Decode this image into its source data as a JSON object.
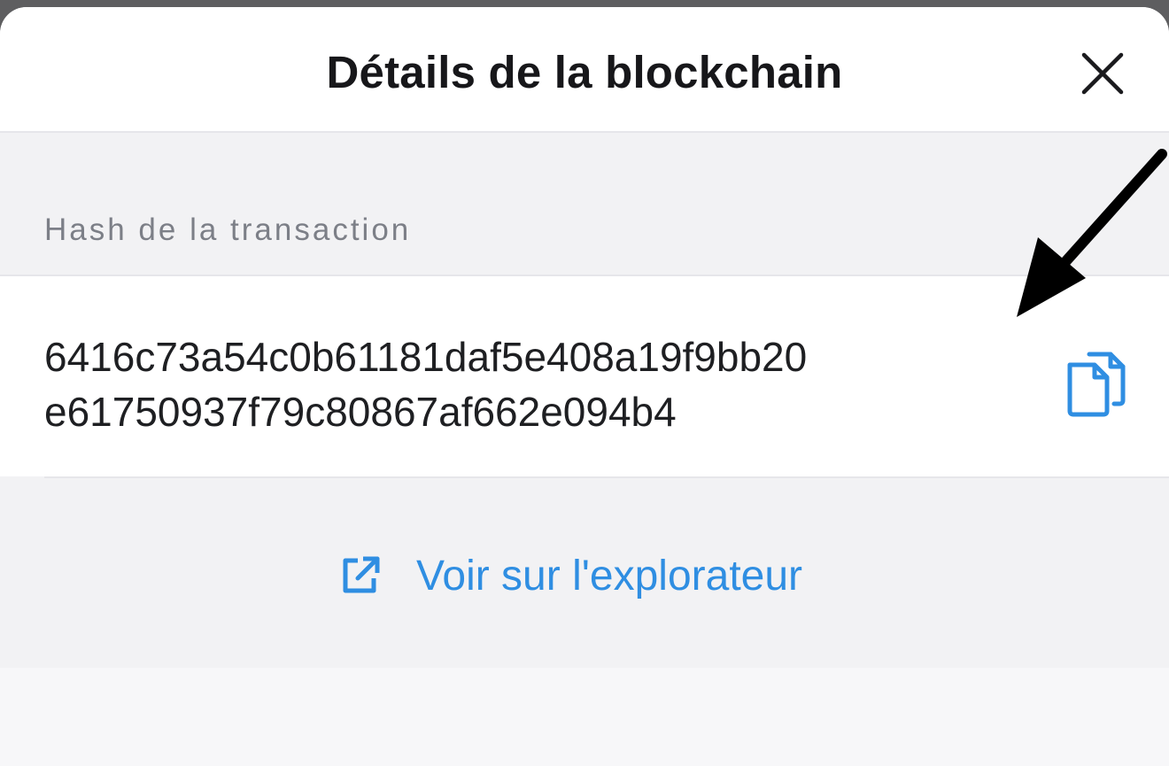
{
  "header": {
    "title": "Détails de la blockchain",
    "close_icon": "close-icon"
  },
  "transaction": {
    "label": "Hash de la transaction",
    "hash_lines": [
      "6416c73a54c0b61181daf5e408a19f9bb20",
      "e61750937f79c80867af662e094b4"
    ],
    "copy_icon": "copy-icon"
  },
  "explorer": {
    "label": "Voir sur l'explorateur",
    "icon": "external-link-icon"
  },
  "annotation": {
    "icon": "pointer-arrow-icon"
  },
  "colors": {
    "accent": "#2f8ee2",
    "background": "#f2f2f4",
    "card": "#ffffff",
    "label": "#7c7f87",
    "text": "#1e1f22"
  }
}
